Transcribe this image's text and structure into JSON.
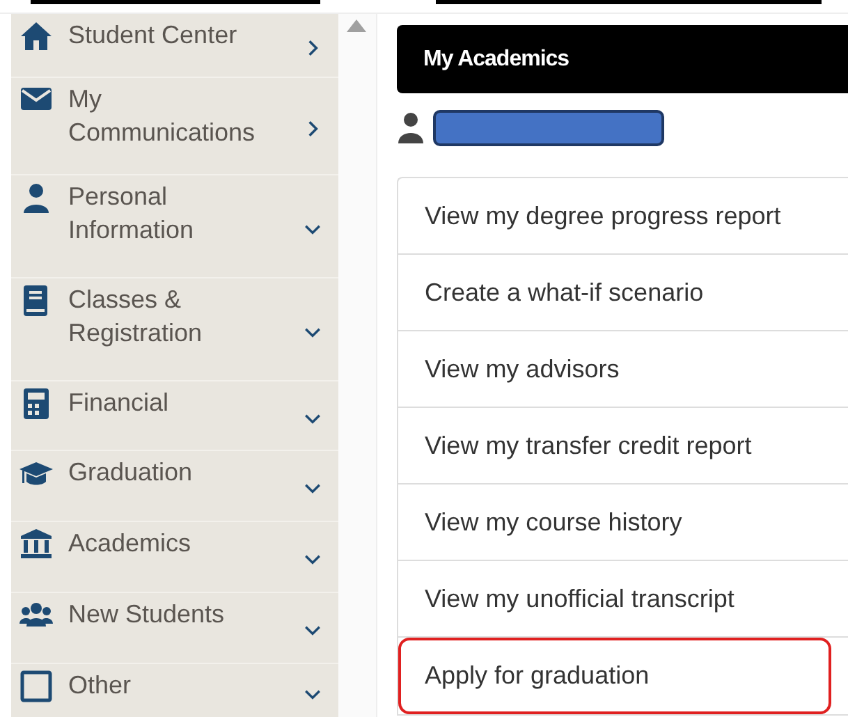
{
  "sidebar": {
    "items": [
      {
        "label": "Student Center",
        "kind": "link"
      },
      {
        "label": "My Communications",
        "kind": "link"
      },
      {
        "label": "Personal Information",
        "kind": "menu"
      },
      {
        "label": "Classes & Registration",
        "kind": "menu"
      },
      {
        "label": "Financial",
        "kind": "menu"
      },
      {
        "label": "Graduation",
        "kind": "menu"
      },
      {
        "label": "Academics",
        "kind": "menu"
      },
      {
        "label": "New Students",
        "kind": "menu"
      },
      {
        "label": "Other",
        "kind": "menu"
      }
    ]
  },
  "panel": {
    "title": "My Academics",
    "links": [
      {
        "label": "View my degree progress report",
        "highlighted": false
      },
      {
        "label": "Create a what-if scenario",
        "highlighted": false
      },
      {
        "label": "View my advisors",
        "highlighted": false
      },
      {
        "label": "View my transfer credit report",
        "highlighted": false
      },
      {
        "label": "View my course history",
        "highlighted": false
      },
      {
        "label": "View my unofficial transcript",
        "highlighted": false
      },
      {
        "label": "Apply for graduation",
        "highlighted": true
      }
    ]
  }
}
